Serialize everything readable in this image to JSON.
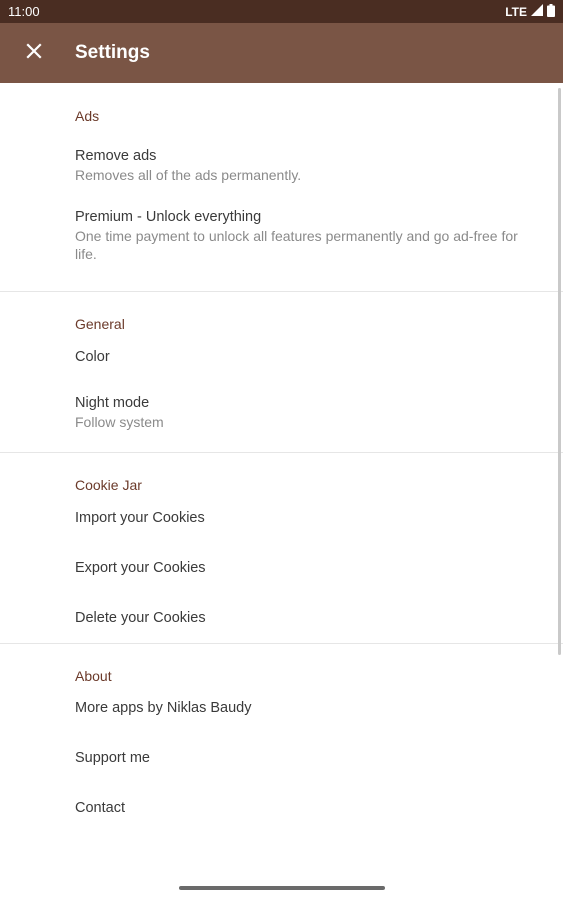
{
  "status_bar": {
    "time": "11:00",
    "network": "LTE"
  },
  "app_bar": {
    "title": "Settings",
    "close_icon": "close-icon"
  },
  "sections": {
    "ads": {
      "title": "Ads",
      "items": [
        {
          "title": "Remove ads",
          "summary": "Removes all of the ads permanently."
        },
        {
          "title": "Premium - Unlock everything",
          "summary": "One time payment to unlock all features permanently and go ad-free for life."
        }
      ]
    },
    "general": {
      "title": "General",
      "items": [
        {
          "title": "Color"
        },
        {
          "title": "Night mode",
          "summary": "Follow system"
        }
      ]
    },
    "cookie_jar": {
      "title": "Cookie Jar",
      "items": [
        {
          "title": "Import your Cookies"
        },
        {
          "title": "Export your Cookies"
        },
        {
          "title": "Delete your Cookies"
        }
      ]
    },
    "about": {
      "title": "About",
      "items": [
        {
          "title": "More apps by Niklas Baudy"
        },
        {
          "title": "Support me"
        },
        {
          "title": "Contact"
        }
      ]
    }
  },
  "colors": {
    "status_bar": "#4a2d22",
    "app_bar": "#7a5545",
    "accent": "#6b3a2a"
  }
}
